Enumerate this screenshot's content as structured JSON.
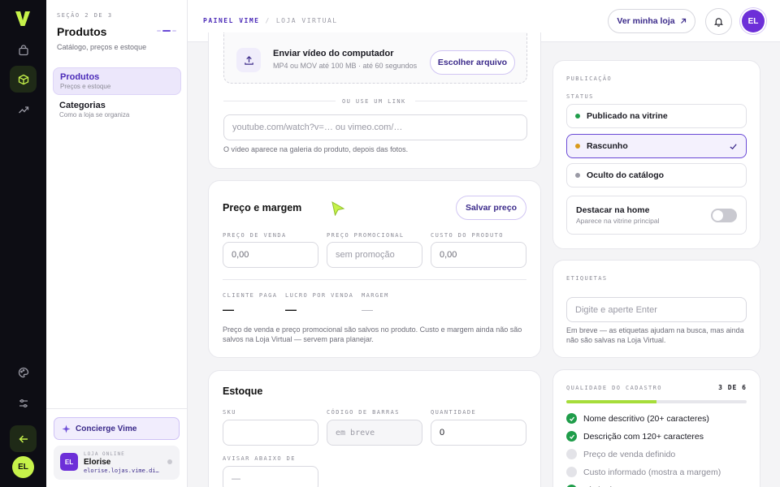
{
  "rail": {
    "logo": "V",
    "icons": [
      "bag-icon",
      "box-icon",
      "trend-icon",
      "palette-icon",
      "sliders-icon",
      "arrow-left-icon"
    ],
    "avatar": "EL"
  },
  "section": {
    "step": "SEÇÃO 2 DE 3",
    "title": "Produtos",
    "subtitle": "Catálogo, preços e estoque",
    "nav": [
      {
        "label": "Produtos",
        "sub": "Preços e estoque"
      },
      {
        "label": "Categorias",
        "sub": "Como a loja se organiza"
      }
    ],
    "concierge": "Concierge Vime",
    "store": {
      "kicker": "LOJA ONLINE",
      "name": "Elorise",
      "url": "elorise.lojas.vime.di…",
      "avatar": "EL"
    }
  },
  "topbar": {
    "crumb_a": "PAINEL VIME",
    "crumb_sep": "/",
    "crumb_b": "LOJA VIRTUAL",
    "store_button": "Ver minha loja",
    "avatar": "EL"
  },
  "video": {
    "upload_title": "Enviar vídeo do computador",
    "upload_sub": "MP4 ou MOV até 100 MB · até 60 segundos",
    "choose": "Escolher arquivo",
    "or_link": "OU USE UM LINK",
    "link_placeholder": "youtube.com/watch?v=… ou vimeo.com/…",
    "hint": "O vídeo aparece na galeria do produto, depois das fotos."
  },
  "price": {
    "title": "Preço e margem",
    "save": "Salvar preço",
    "sale_label": "PREÇO DE VENDA",
    "sale_value": "0,00",
    "promo_label": "PREÇO PROMOCIONAL",
    "promo_placeholder": "sem promoção",
    "cost_label": "CUSTO DO PRODUTO",
    "cost_value": "0,00",
    "client_label": "CLIENTE PAGA",
    "client_value": "—",
    "profit_label": "LUCRO POR VENDA",
    "profit_value": "—",
    "margin_label": "MARGEM",
    "margin_value": "—",
    "hint": "Preço de venda e preço promocional são salvos no produto. Custo e margem ainda não são salvos na Loja Virtual — servem para planejar."
  },
  "stock": {
    "title": "Estoque",
    "sku_label": "SKU",
    "sku_value": "",
    "barcode_label": "CÓDIGO DE BARRAS",
    "barcode_placeholder": "em breve",
    "qty_label": "QUANTIDADE",
    "qty_value": "0",
    "warn_label": "AVISAR ABAIXO DE",
    "warn_value": "—"
  },
  "publication": {
    "title": "PUBLICAÇÃO",
    "status_label": "STATUS",
    "options": [
      {
        "label": "Publicado na vitrine",
        "color": "#1f9d4a"
      },
      {
        "label": "Rascunho",
        "color": "#d99a1c"
      },
      {
        "label": "Oculto do catálogo",
        "color": "#9a9aa5"
      }
    ],
    "selected": 1,
    "highlight_title": "Destacar na home",
    "highlight_sub": "Aparece na vitrine principal",
    "highlight_on": false
  },
  "tags": {
    "title": "ETIQUETAS",
    "placeholder": "Digite e aperte Enter",
    "hint": "Em breve — as etiquetas ajudam na busca, mas ainda não são salvas na Loja Virtual."
  },
  "quality": {
    "title": "QUALIDADE DO CADASTRO",
    "score": "3 de 6",
    "progress": 0.5,
    "items": [
      {
        "label": "Nome descritivo (20+ caracteres)",
        "done": true
      },
      {
        "label": "Descrição com 120+ caracteres",
        "done": true
      },
      {
        "label": "Preço de venda definido",
        "done": false
      },
      {
        "label": "Custo informado (mostra a margem)",
        "done": false
      },
      {
        "label": "Título de SEO",
        "done": true
      }
    ]
  },
  "colors": {
    "accent": "#4b2bb8",
    "brand_green": "#c6f24a",
    "success": "#1f9d4a"
  }
}
